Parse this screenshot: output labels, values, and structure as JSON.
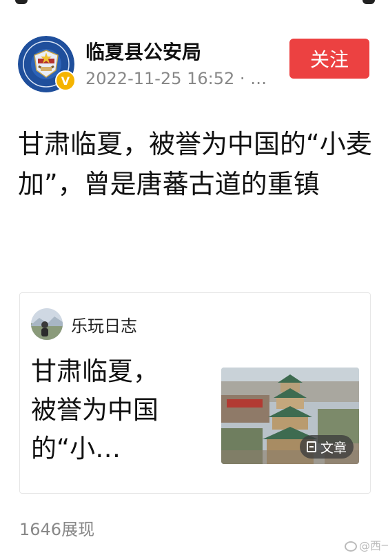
{
  "header": {
    "account_name": "临夏县公安局",
    "timestamp": "2022-11-25 16:52",
    "meta_suffix": " · …",
    "follow_label": "关注",
    "verified_mark": "V",
    "avatar_icon": "police-emblem-icon"
  },
  "post": {
    "headline": "甘肃临夏，被誉为中国的“小麦加”，曾是唐蕃古道的重镇"
  },
  "card": {
    "author": "乐玩日志",
    "title_lines": [
      "甘肃临夏，",
      "被誉为中国",
      "的“小…"
    ],
    "badge_label": "文章",
    "badge_icon": "document-icon"
  },
  "stats": {
    "views": "1646展现"
  },
  "watermark": {
    "text": "@西一"
  },
  "colors": {
    "follow": "#ec4141",
    "verified": "#f5b400",
    "meta": "#888888"
  }
}
